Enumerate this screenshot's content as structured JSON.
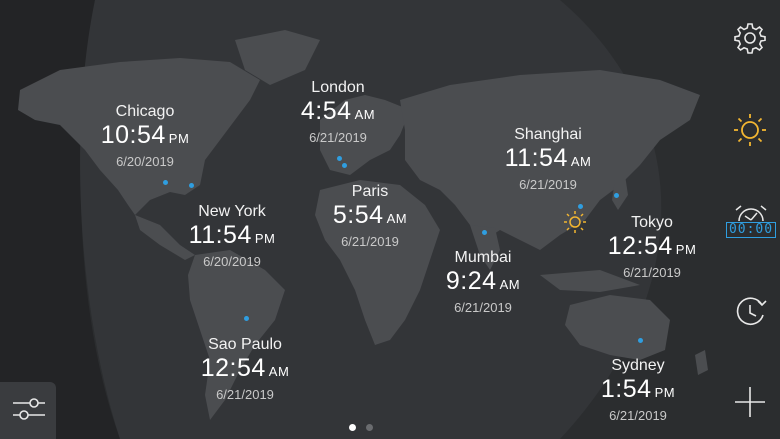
{
  "cities": [
    {
      "name": "Chicago",
      "time": "10:54",
      "ampm": "PM",
      "date": "6/20/2019"
    },
    {
      "name": "London",
      "time": "4:54",
      "ampm": "AM",
      "date": "6/21/2019"
    },
    {
      "name": "Shanghai",
      "time": "11:54",
      "ampm": "AM",
      "date": "6/21/2019"
    },
    {
      "name": "Paris",
      "time": "5:54",
      "ampm": "AM",
      "date": "6/21/2019"
    },
    {
      "name": "New York",
      "time": "11:54",
      "ampm": "PM",
      "date": "6/20/2019"
    },
    {
      "name": "Tokyo",
      "time": "12:54",
      "ampm": "PM",
      "date": "6/21/2019"
    },
    {
      "name": "Mumbai",
      "time": "9:24",
      "ampm": "AM",
      "date": "6/21/2019"
    },
    {
      "name": "Sao Paulo",
      "time": "12:54",
      "ampm": "AM",
      "date": "6/21/2019"
    },
    {
      "name": "Sydney",
      "time": "1:54",
      "ampm": "PM",
      "date": "6/21/2019"
    }
  ],
  "sidebar": {
    "icons": [
      "gear-icon",
      "sun-icon",
      "alarm-clock-icon",
      "world-clock-icon",
      "plus-icon"
    ],
    "alarm_display": "00:00"
  },
  "colors": {
    "background": "#2b2d2f",
    "night_overlay": "#1f2022",
    "land": "#4a4c4f",
    "accent_blue": "#2f9ee0",
    "sun_yellow": "#f3b631"
  },
  "pagination": {
    "pages": 2,
    "current": 1
  }
}
